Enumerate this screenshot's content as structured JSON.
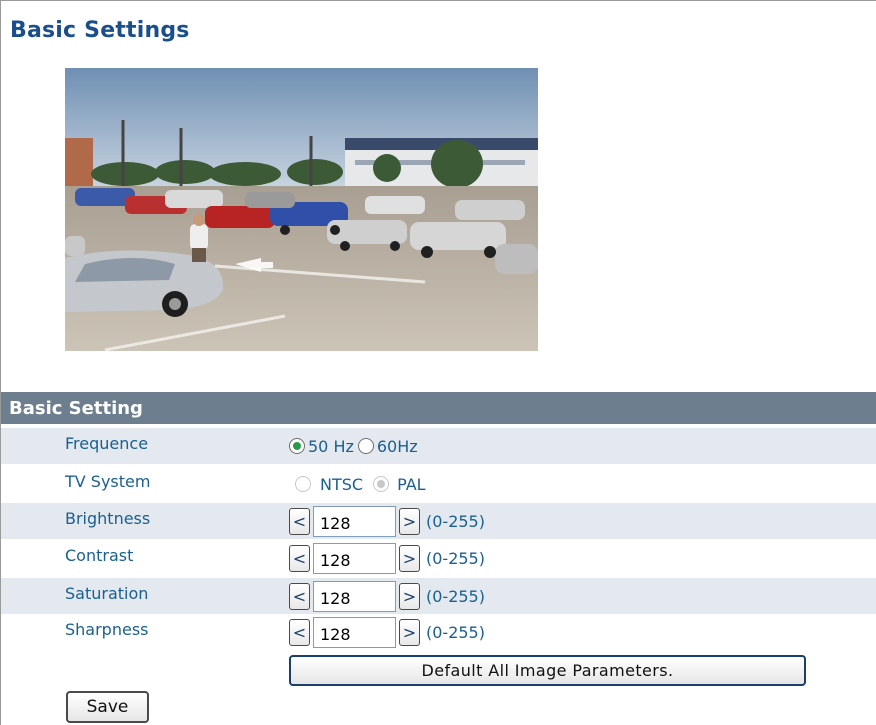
{
  "page": {
    "title": "Basic Settings"
  },
  "section": {
    "title": "Basic Setting"
  },
  "settings": {
    "frequence": {
      "label": "Frequence",
      "options": [
        {
          "label": "50 Hz",
          "selected": true,
          "disabled": false
        },
        {
          "label": "60Hz",
          "selected": false,
          "disabled": false
        }
      ]
    },
    "tv_system": {
      "label": "TV System",
      "options": [
        {
          "label": "NTSC",
          "selected": false,
          "disabled": true
        },
        {
          "label": "PAL",
          "selected": true,
          "disabled": true
        }
      ]
    },
    "brightness": {
      "label": "Brightness",
      "value": "128",
      "range": "(0-255)",
      "dec": "<",
      "inc": ">"
    },
    "contrast": {
      "label": "Contrast",
      "value": "128",
      "range": "(0-255)",
      "dec": "<",
      "inc": ">"
    },
    "saturation": {
      "label": "Saturation",
      "value": "128",
      "range": "(0-255)",
      "dec": "<",
      "inc": ">"
    },
    "sharpness": {
      "label": "Sharpness",
      "value": "128",
      "range": "(0-255)",
      "dec": "<",
      "inc": ">"
    }
  },
  "buttons": {
    "default_all": "Default All Image Parameters.",
    "save": "Save"
  },
  "colors": {
    "title": "#1a4f8b",
    "section_header": "#6d7f8e",
    "row_shade": "#e4e9ef",
    "label_text": "#1a5f8f",
    "radio_selected": "#2a9a4a"
  }
}
